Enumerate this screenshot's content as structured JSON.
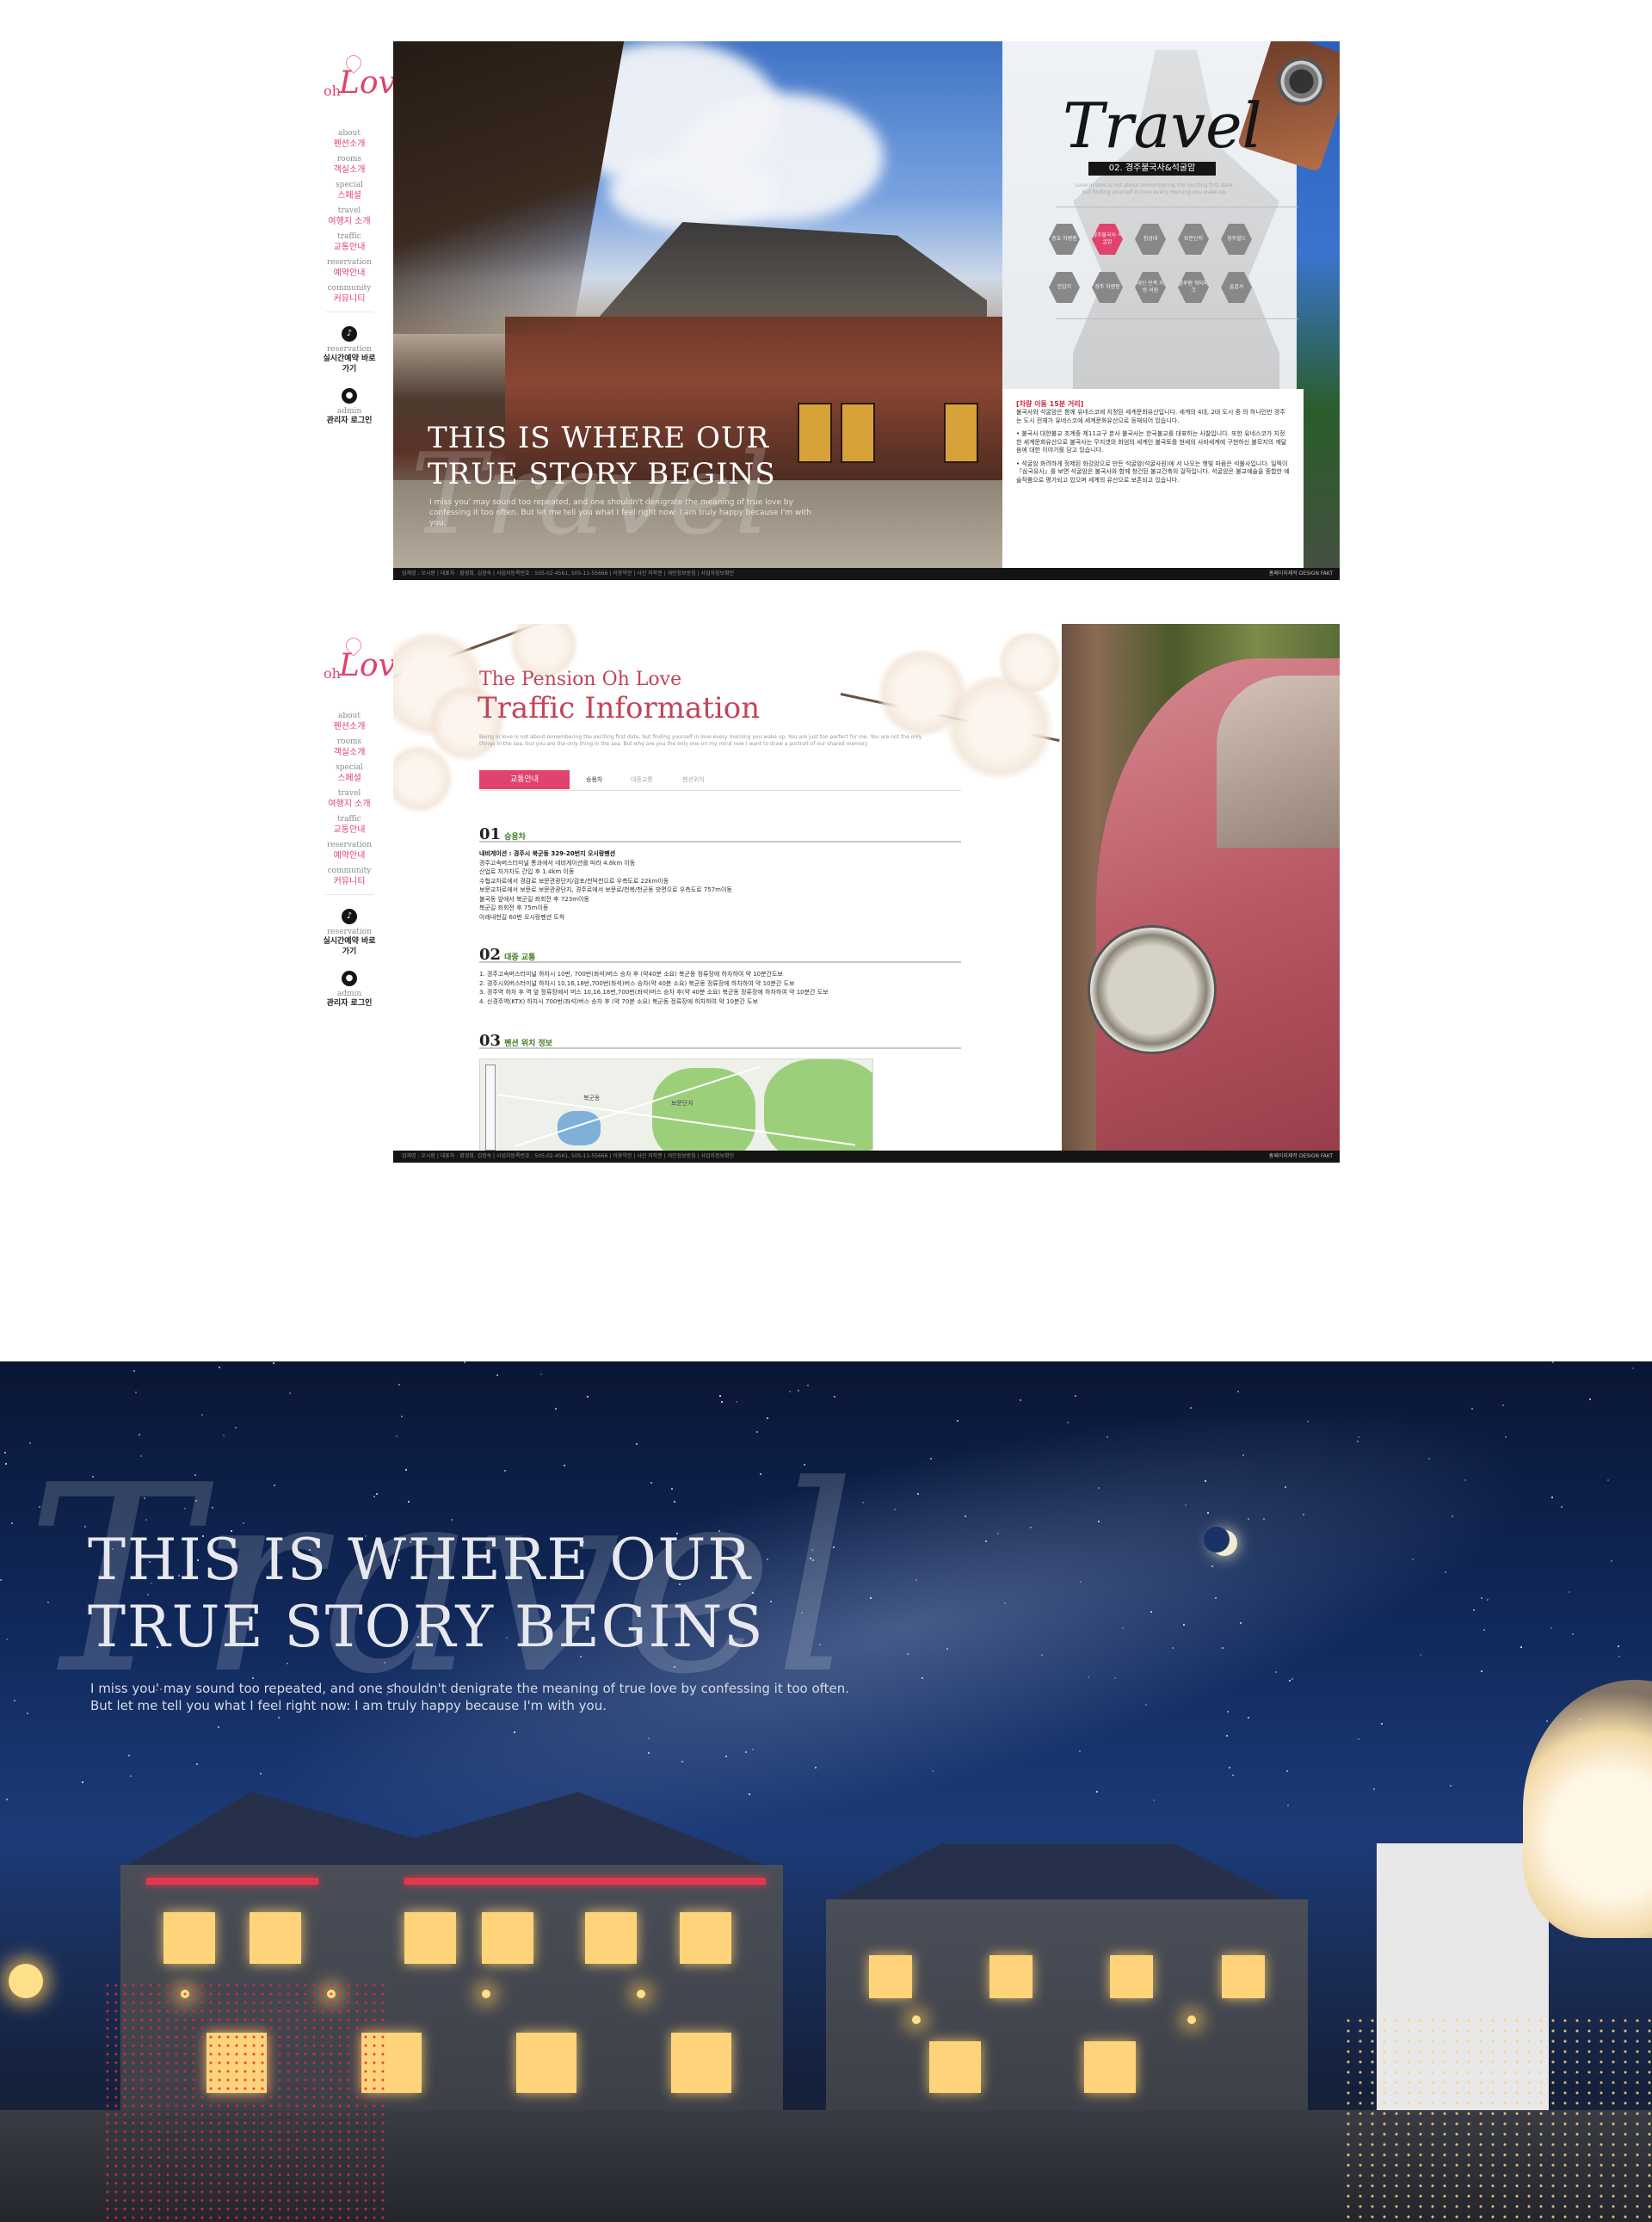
{
  "sidebar": {
    "logo_oh": "oh",
    "logo_love": "Love",
    "nav": [
      {
        "en": "about",
        "ko": "펜션소개"
      },
      {
        "en": "rooms",
        "ko": "객실소개"
      },
      {
        "en": "special",
        "ko": "스페셜"
      },
      {
        "en": "travel",
        "ko": "여행지 소개"
      },
      {
        "en": "traffic",
        "ko": "교통안내"
      },
      {
        "en": "reservation",
        "ko": "예약안내"
      },
      {
        "en": "community",
        "ko": "커뮤니티"
      }
    ],
    "quick": [
      {
        "icon": "music-note-icon",
        "en": "reservation",
        "ko": "실시간예약 바로가기"
      },
      {
        "icon": "user-icon",
        "en": "admin",
        "ko": "관리자 로그인"
      }
    ]
  },
  "panel1": {
    "headline_line1": "THIS IS WHERE OUR",
    "headline_line2": "TRUE STORY BEGINS",
    "subtext": "I miss you' may sound too repeated, and one shouldn't denigrate the meaning of true love by confessing it too often. But let me tell you what I feel right now: I am truly happy because I'm with you.",
    "script_word": "Travel",
    "travel_title": "Travel",
    "travel_tag": "02. 경주불국사&석굴암",
    "travel_desc": "Love in love is not about remembering the exciting first date, but finding yourself in love every morning you wake up.",
    "hex_row1": [
      "충효 차량원",
      "경주불국사 석굴암",
      "첨성대",
      "보문단지",
      "경주월드"
    ],
    "hex_row2": [
      "안압지",
      "경주 차량원",
      "대신 민족 지방 서원",
      "블루원 워터파크",
      "골굴사"
    ],
    "text_red": "[차량 이동 15분 거리]",
    "text_p1": "불국사와 석굴암은 함께 유네스코에 지정된 세계문화유산입니다. 세계의 4대, 2대 도시 중 의 하나인만 경주는 도시 전체가 유네스코에 세계문화유산으로 등재되어 있습니다.",
    "text_p2": "• 불국사 대한불교 조계종 제11교구 본사 불국사는 한국불교를 대표하는 사찰입니다. 또한 유네스코가 지정한 세계문화유산으로 불국사는 무지갯의 화엄의 세계인 불국토를 현세의 사바세계에 구현하신 불모지의 깨달음에 대한 이야기를 담고 있습니다.",
    "text_p3": "• 석굴암 화려하게 정제된 화강암으로 만든 석굴암(석굴사원)에 서 나오는 햇빛 마음은 석불사입니다. 일찍이 『삼국유사』를 보면 석굴암은 불국사와 함께 창건된 불교건축의 걸작입니다. 석굴암은 불교예술을 종합한 예술작품으로 평가되고 있으며 세계의 유산으로 보존되고 있습니다.",
    "footer_left": "업체명 : 오시랑  |  대표자 : 황영희, 김정숙  |  사업자등록번호 : 505-02-4561, 505-11-55666  |  이용약관  |  사진 저작권  |  개인정보방침  |  사업자정보확인",
    "footer_right": "홈페이지제작 DESIGN FAKT"
  },
  "panel2": {
    "subtitle": "The Pension Oh Love",
    "title": "Traffic Information",
    "desc": "Being in love is not about remembering the exciting first date, but finding yourself in love every morning you wake up. You are just too perfect for me. You are not the only things in the sea, but you are the only thing in the sea. But why are you the only one on my mind now I want to draw a portrait of our shared memory",
    "tabs": [
      "교통안내",
      "승용차",
      "대중교통",
      "펜션위치"
    ],
    "sections": [
      {
        "num": "01",
        "label": "승용차"
      },
      {
        "num": "02",
        "label": "대중 교통"
      },
      {
        "num": "03",
        "label": "펜션 위치 정보"
      }
    ],
    "car_address": "내비게이션 : 경주시 북군동 329-20번지 오시랑펜션",
    "car_lines": [
      "경주고속버스터미널 통과에서 네비게이션를 따라 4.8km 이동",
      "산업로 자가차도 간입 후 1.4km 이동",
      "수협교차로에서 경감로 보문관광단지/감포/천덕천으로 우측도로 22km이동",
      "보문교차로에서 보문로 보문관광단지, 경주로에서 보문로/천북/천군동 방면으로 우측도로 757m이동",
      "불국동 앞에서 북군길 좌회전 후 723m이동",
      "북군길 좌회전 후 75m이동",
      "아래내천길 60번 오시랑펜션 도착"
    ],
    "transit_lines": [
      "1. 경주고속버스터미널 하차시 10번, 700번(좌석)버스 승차 후 (약40분 소요) 북군동 정류장에 하차하여 약 10분간도보",
      "2. 경주시외버스터미널 하차시 10,16,18번,700번(좌석)버스 승차(약 40분 소요) 북군동 정류장에 하차하여 약 10분간 도보",
      "3. 경주역 하차 후 역 앞 정류장에서 버스 10,16,18번,700번(좌석)버스 승차 후(약 40분 소요) 북군동 정류장에 하차하여 약 10분간 도보",
      "4. 신경주역(KTX) 하차시 700번(좌석)버스 승차 후 (약 70분 소요) 북군동 정류장에 하차하여 약 10분간 도보"
    ],
    "map_label": "북군동",
    "map_label2": "보문단지",
    "footer_left": "업체명 : 오시랑  |  대표자 : 황영희, 김정숙  |  사업자등록번호 : 505-02-4561, 505-11-55666  |  이용약관  |  사진 저작권  |  개인정보방침  |  사업자정보확인",
    "footer_right": "홈페이지제작 DESIGN FAKT"
  },
  "hero": {
    "script_word": "Travel",
    "headline_line1": "THIS IS WHERE OUR",
    "headline_line2": "TRUE STORY BEGINS",
    "sub_line1": "I miss you' may sound too repeated, and one shouldn't denigrate the meaning of true love by confessing it too often.",
    "sub_line2": "But let me tell you what I feel right now: I am truly happy because I'm with you."
  },
  "colors": {
    "accent": "#e0436c",
    "title_red": "#c34459",
    "footer": "#141414",
    "sky_dark": "#0a1634"
  }
}
